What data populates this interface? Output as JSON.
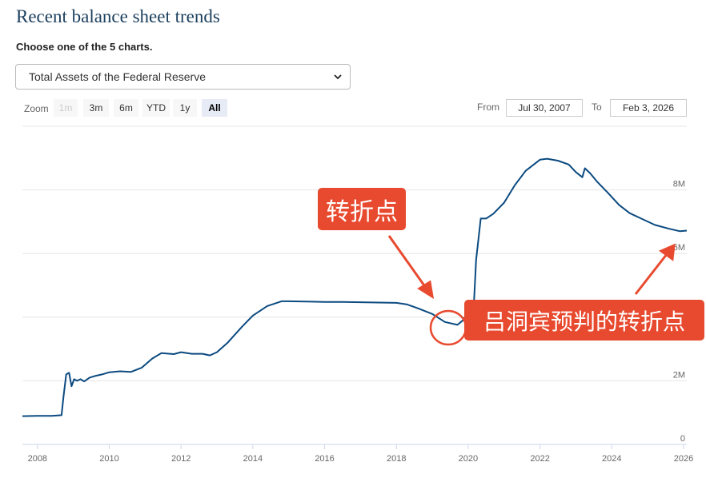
{
  "page": {
    "title": "Recent balance sheet trends",
    "subtitle": "Choose one of the 5 charts.",
    "select": {
      "value": "Total Assets of the Federal Reserve"
    }
  },
  "toolbar": {
    "zoom_label": "Zoom",
    "buttons": [
      "1m",
      "3m",
      "6m",
      "YTD",
      "1y",
      "All"
    ],
    "active": "All",
    "disabled": [
      "1m"
    ],
    "from_label": "From",
    "from_value": "Jul 30, 2007",
    "to_label": "To",
    "to_value": "Feb 3, 2026"
  },
  "annotations": {
    "turning_point": "转折点",
    "predicted": "吕洞宾预判的转折点"
  },
  "colors": {
    "line": "#0b4a80",
    "annotation": "#e84a2f",
    "grid": "#e6e6e6"
  },
  "chart_data": {
    "type": "line",
    "title": "",
    "xlabel": "",
    "ylabel": "",
    "x_ticks": [
      "2008",
      "2010",
      "2012",
      "2014",
      "2016",
      "2018",
      "2020",
      "2022",
      "2024",
      "2026"
    ],
    "y_ticks": [
      "0",
      "2M",
      "6M",
      "8M"
    ],
    "xlim": [
      2007.58,
      2026.09
    ],
    "ylim": [
      0,
      10000000
    ],
    "grid": true,
    "series": [
      {
        "x": [
          2007.58,
          2008.0,
          2008.4,
          2008.67,
          2008.72,
          2008.8,
          2008.88,
          2008.95,
          2009.02,
          2009.1,
          2009.2,
          2009.3,
          2009.45,
          2009.6,
          2009.8,
          2010.0,
          2010.3,
          2010.6,
          2010.9,
          2011.2,
          2011.45,
          2011.8,
          2012.0,
          2012.3,
          2012.6,
          2012.8,
          2013.0,
          2013.3,
          2013.7,
          2014.0,
          2014.4,
          2014.8,
          2015.0,
          2015.5,
          2016.0,
          2016.5,
          2017.0,
          2017.5,
          2018.0,
          2018.3,
          2018.6,
          2019.0,
          2019.35,
          2019.7,
          2019.85,
          2020.0,
          2020.15,
          2020.22,
          2020.35,
          2020.5,
          2020.7,
          2021.0,
          2021.3,
          2021.6,
          2022.0,
          2022.2,
          2022.5,
          2022.8,
          2023.0,
          2023.18,
          2023.25,
          2023.4,
          2023.6,
          2023.9,
          2024.2,
          2024.5,
          2024.8,
          2025.2,
          2025.6,
          2025.9,
          2026.09
        ],
        "y": [
          890000,
          900000,
          900000,
          920000,
          1450000,
          2200000,
          2250000,
          1830000,
          2050000,
          2000000,
          2050000,
          1980000,
          2100000,
          2150000,
          2200000,
          2270000,
          2300000,
          2280000,
          2410000,
          2700000,
          2870000,
          2840000,
          2900000,
          2850000,
          2850000,
          2800000,
          2900000,
          3200000,
          3700000,
          4050000,
          4350000,
          4500000,
          4500000,
          4490000,
          4480000,
          4480000,
          4470000,
          4460000,
          4450000,
          4400000,
          4280000,
          4100000,
          3850000,
          3760000,
          3900000,
          4170000,
          4200000,
          5800000,
          7100000,
          7100000,
          7250000,
          7600000,
          8150000,
          8600000,
          8950000,
          8980000,
          8920000,
          8800000,
          8560000,
          8400000,
          8680000,
          8520000,
          8250000,
          7900000,
          7530000,
          7270000,
          7110000,
          6900000,
          6780000,
          6700000,
          6720000
        ]
      }
    ]
  }
}
